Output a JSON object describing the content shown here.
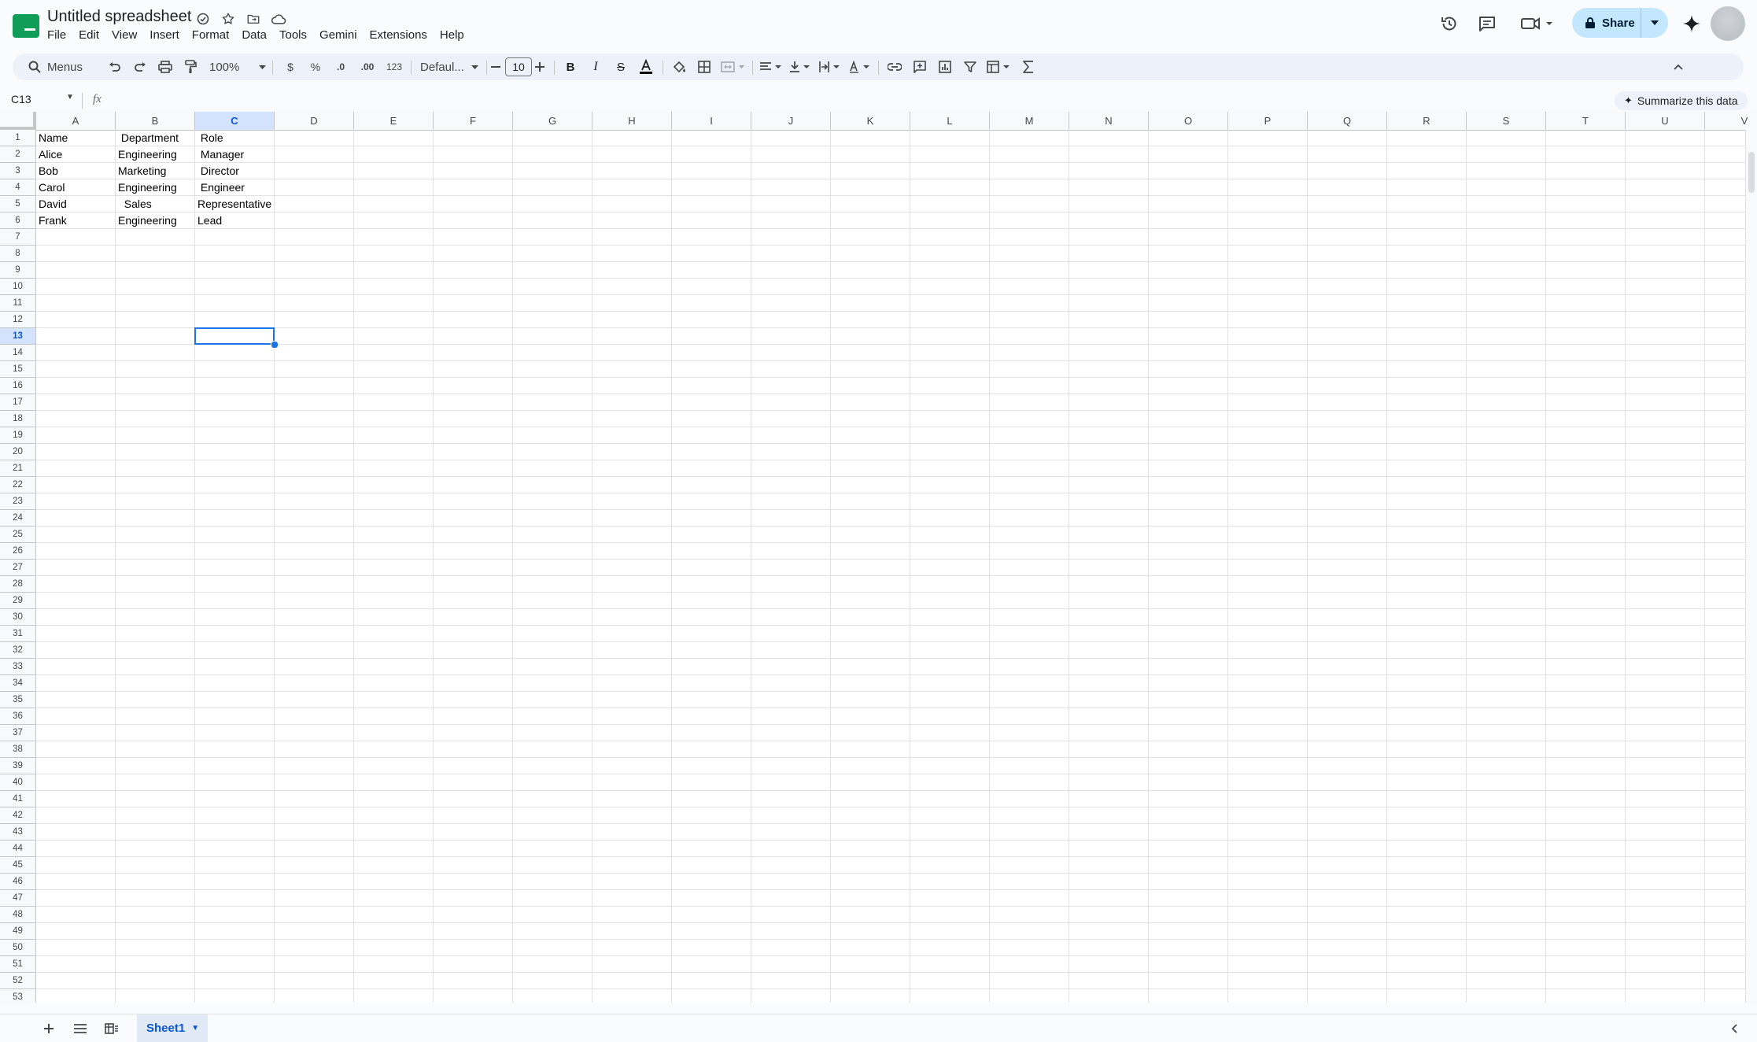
{
  "app": {
    "doc_title": "Untitled spreadsheet",
    "menus": [
      "File",
      "Edit",
      "View",
      "Insert",
      "Format",
      "Data",
      "Tools",
      "Gemini",
      "Extensions",
      "Help"
    ],
    "share_label": "Share"
  },
  "toolbar": {
    "search_label": "Menus",
    "zoom": "100%",
    "currency_label": "$",
    "percent_label": "%",
    "decrease_decimal_label": ".0",
    "increase_decimal_label": ".00",
    "number_format_label": "123",
    "font_name": "Defaul...",
    "font_size": "10"
  },
  "formula_bar": {
    "name_box": "C13",
    "fx_label": "fx",
    "summarize_label": "Summarize this data"
  },
  "grid": {
    "columns": [
      "A",
      "B",
      "C",
      "D",
      "E",
      "F",
      "G",
      "H",
      "I",
      "J",
      "K",
      "L",
      "M",
      "N",
      "O",
      "P",
      "Q",
      "R",
      "S",
      "T",
      "U",
      "V"
    ],
    "selected_column": "C",
    "selected_row": 13,
    "row_count": 53,
    "rows": [
      [
        "Name",
        " Department",
        " Role"
      ],
      [
        "Alice",
        "Engineering",
        " Manager"
      ],
      [
        "Bob",
        "Marketing",
        " Director"
      ],
      [
        "Carol",
        "Engineering",
        " Engineer"
      ],
      [
        "David",
        "  Sales",
        "Representative"
      ],
      [
        "Frank",
        "Engineering",
        "Lead"
      ]
    ]
  },
  "sheets": {
    "active_sheet": "Sheet1"
  },
  "colors": {
    "accent": "#1a73e8",
    "share_bg": "#c2e7ff",
    "toolbar_bg": "#edf2fa",
    "selection_header_bg": "#d3e3fd"
  }
}
